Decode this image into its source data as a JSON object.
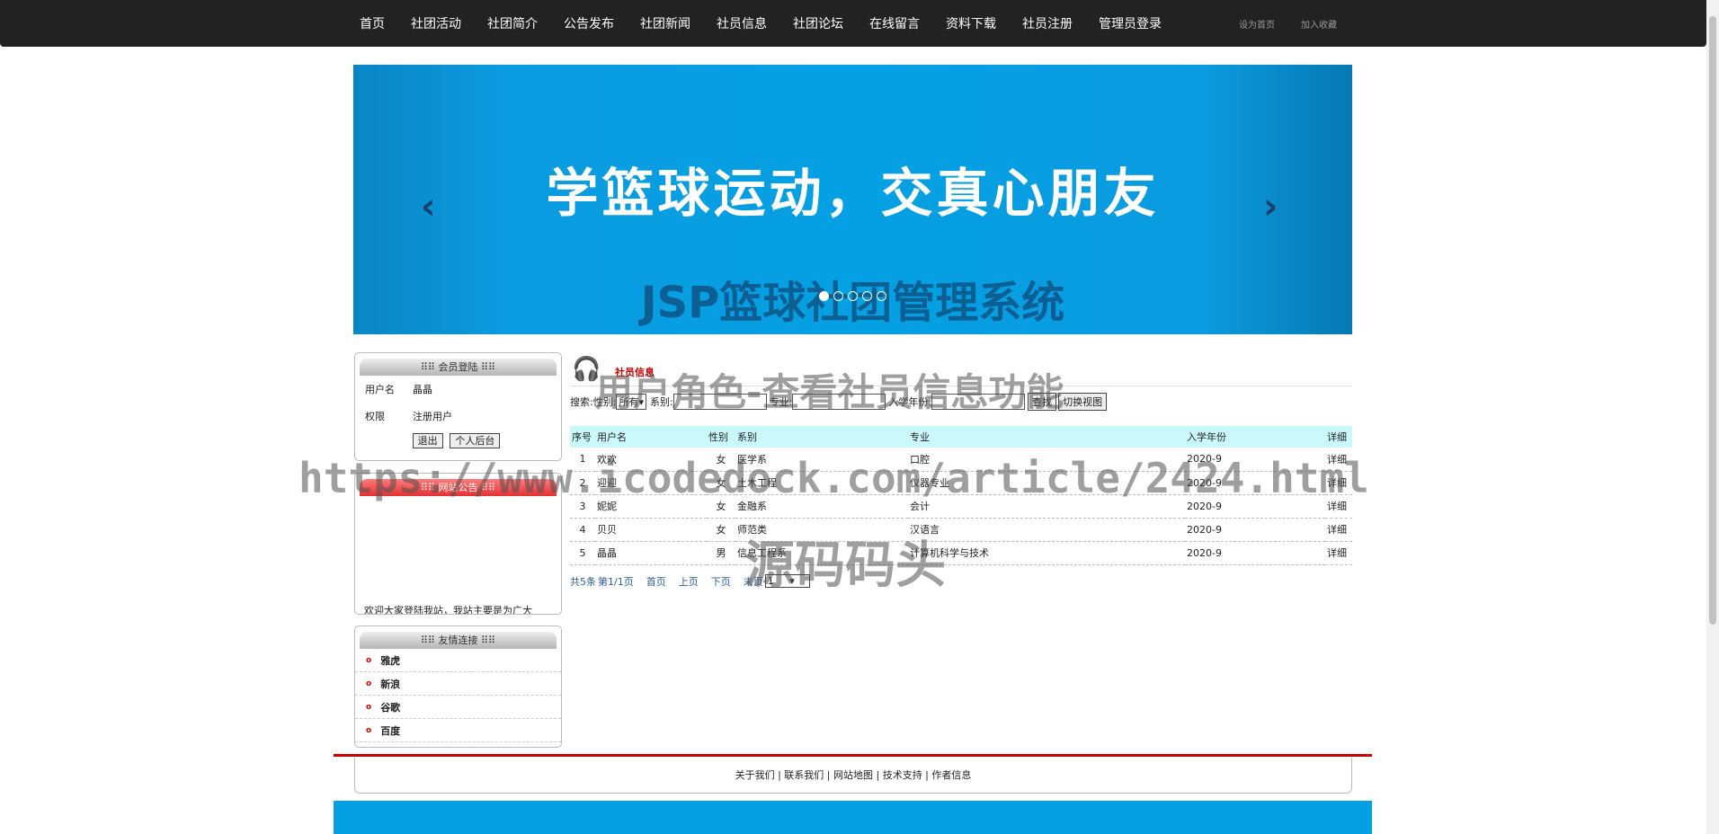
{
  "nav": {
    "items": [
      "首页",
      "社团活动",
      "社团简介",
      "公告发布",
      "社团新闻",
      "社员信息",
      "社团论坛",
      "在线留言",
      "资料下载",
      "社员注册",
      "管理员登录"
    ],
    "util": [
      "设为首页",
      "加入收藏"
    ]
  },
  "banner": {
    "slogan": "学篮球运动，交真心朋友",
    "system_title": "JSP篮球社团管理系统",
    "prev": "‹",
    "next": "›"
  },
  "login_box": {
    "title": "⠿⠿ 会员登陆 ⠿⠿",
    "rows": [
      {
        "key": "用户名",
        "value": "晶晶"
      },
      {
        "key": "权限",
        "value": "注册用户"
      }
    ],
    "logout": "退出",
    "backend": "个人后台"
  },
  "notice_box": {
    "title": "⠿⠿ 网站公告 ⠿⠿",
    "text": "欢迎大家登陆我站，我站主要是为广大"
  },
  "links_box": {
    "title": "⠿⠿ 友情连接 ⠿⠿",
    "items": [
      "雅虎",
      "新浪",
      "谷歌",
      "百度"
    ]
  },
  "members": {
    "section_title": "社员信息",
    "search": {
      "label_search": "搜索:",
      "label_gender": "性别:",
      "gender_value": "所有",
      "label_dept": "系别:",
      "label_major": "专业:",
      "label_year": "入学年份:",
      "btn_search": "查找",
      "btn_switch": "切换视图"
    },
    "headers": [
      "序号",
      "用户名",
      "性别",
      "系别",
      "专业",
      "入学年份",
      "详细"
    ],
    "rows": [
      [
        "1",
        "欢欢",
        "女",
        "医学系",
        "口腔",
        "2020-9",
        "详细"
      ],
      [
        "2",
        "迎迎",
        "女",
        "土木工程",
        "仪器专业",
        "2020-9",
        "详细"
      ],
      [
        "3",
        "妮妮",
        "女",
        "金融系",
        "会计",
        "2020-9",
        "详细"
      ],
      [
        "4",
        "贝贝",
        "女",
        "师范类",
        "汉语言",
        "2020-9",
        "详细"
      ],
      [
        "5",
        "晶晶",
        "男",
        "信息工程系",
        "计算机科学与技术",
        "2020-9",
        "详细"
      ]
    ],
    "pager": {
      "total": "共5条",
      "page": "第1/1页",
      "first": "首页",
      "prev": "上页",
      "next": "下页",
      "last": "末页",
      "select": "1"
    }
  },
  "footer": {
    "links": "关于我们 | 联系我们 | 网站地图 | 技术支持 | 作者信息"
  },
  "watermarks": {
    "caption": "用户角色-查看社员信息功能",
    "url": "https://www.icodedock.com/article/2424.html",
    "brand": "源码码头"
  }
}
